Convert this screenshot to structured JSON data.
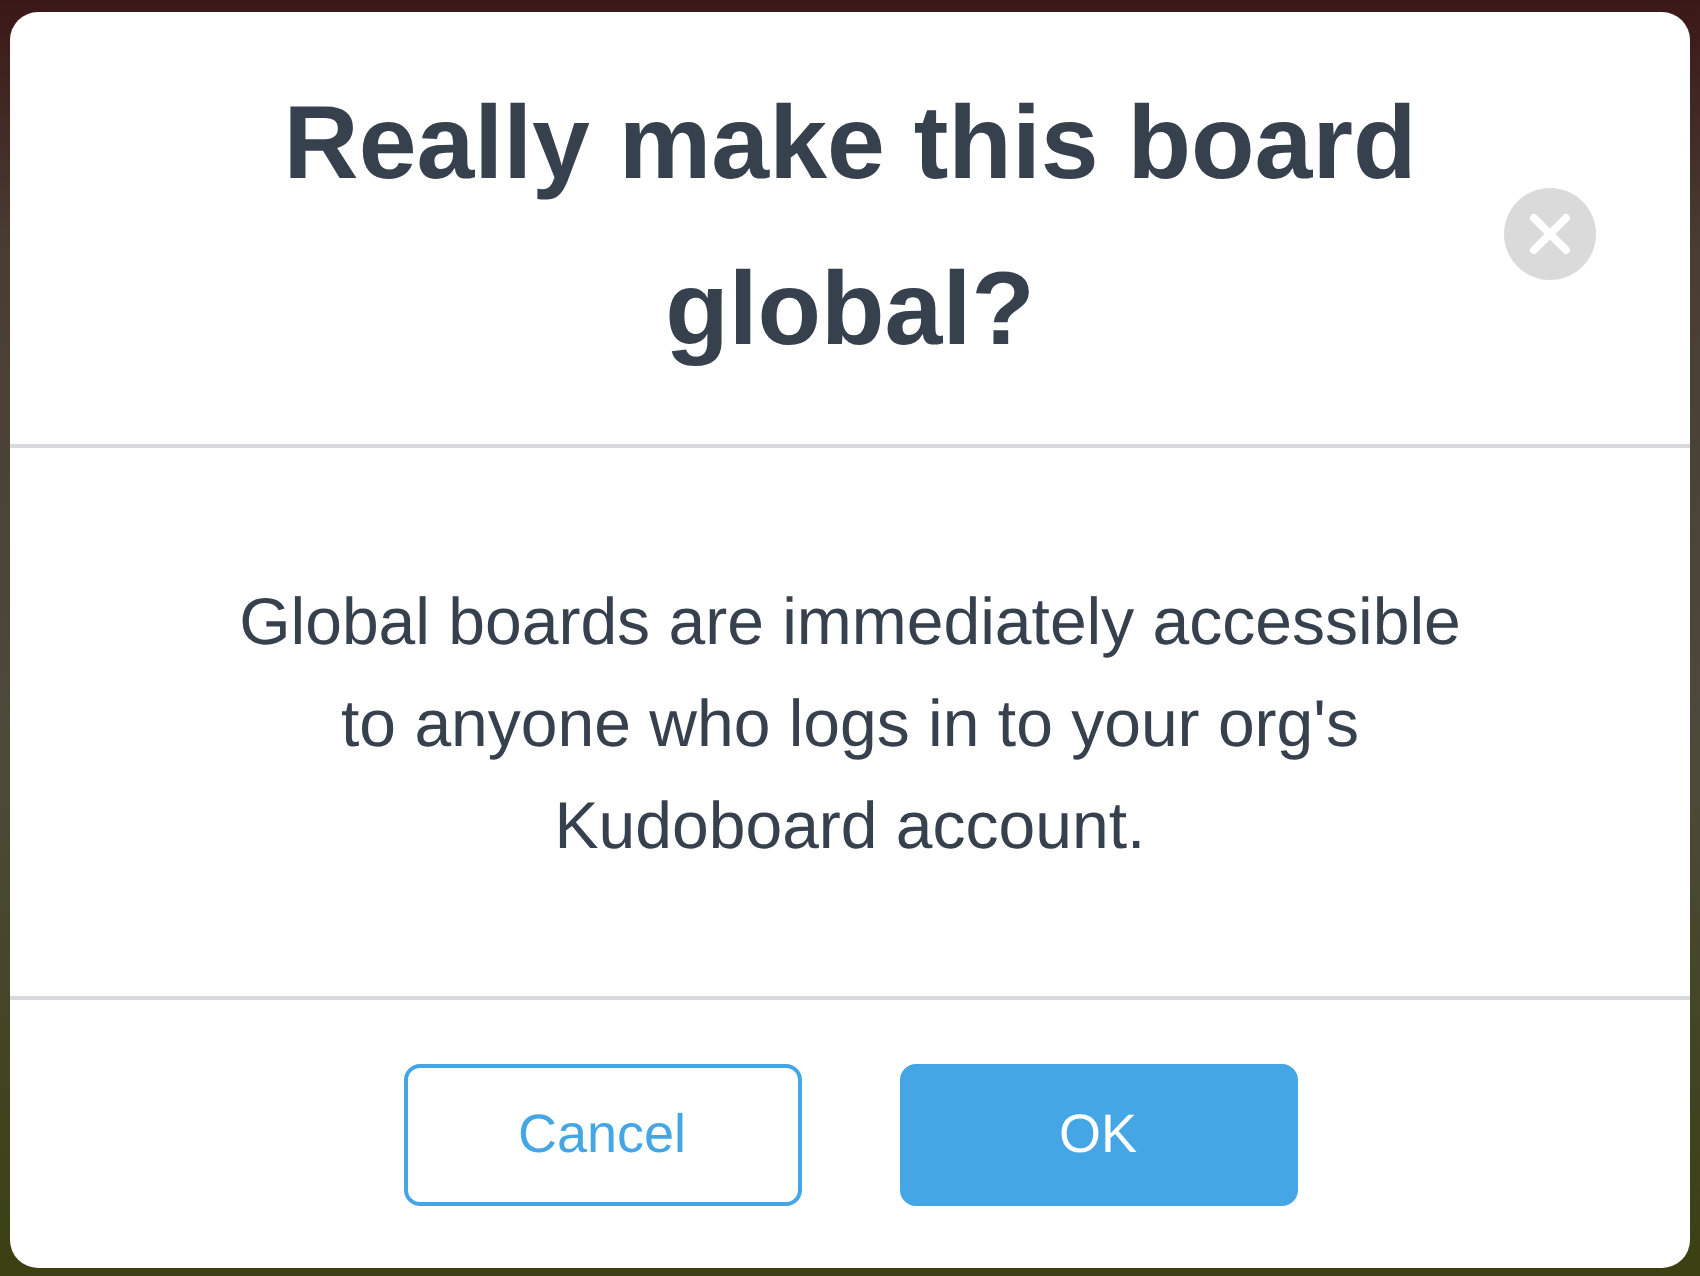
{
  "dialog": {
    "title": "Really make this board global?",
    "message": "Global boards are immediately accessible to anyone who logs in to your org's Kudoboard account.",
    "buttons": [
      {
        "label": "Cancel",
        "kind": "secondary"
      },
      {
        "label": "OK",
        "kind": "primary"
      }
    ]
  }
}
